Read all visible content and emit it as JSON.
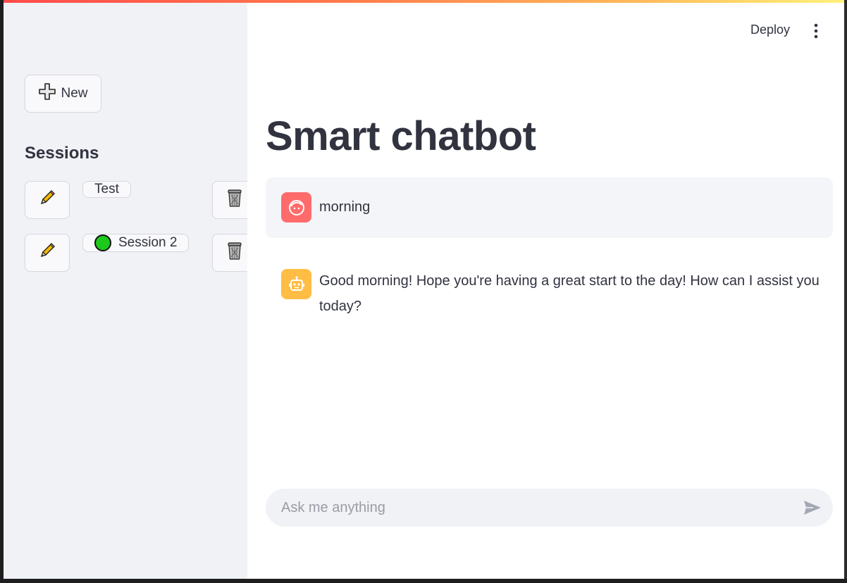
{
  "app": {
    "title": "Smart chatbot",
    "accent_color": "#ff4b4b"
  },
  "toolbar": {
    "deploy_label": "Deploy",
    "menu_icon": "kebab-menu-icon"
  },
  "sidebar": {
    "new_button_label": "New",
    "new_icon": "plus-icon",
    "sessions_heading": "Sessions",
    "sessions": [
      {
        "label": "Test",
        "active": false,
        "edit_icon": "pencil-icon",
        "delete_icon": "trash-icon"
      },
      {
        "label": "Session 2",
        "active": true,
        "status_icon": "green-circle-icon",
        "edit_icon": "pencil-icon",
        "delete_icon": "trash-icon"
      }
    ]
  },
  "chat": {
    "messages": [
      {
        "role": "user",
        "avatar_icon": "user-face-icon",
        "text": "morning"
      },
      {
        "role": "assistant",
        "avatar_icon": "robot-icon",
        "text": "Good morning! Hope you're having a great start to the day! How can I assist you today?"
      }
    ],
    "input": {
      "placeholder": "Ask me anything",
      "value": ""
    },
    "send_icon": "send-icon"
  }
}
